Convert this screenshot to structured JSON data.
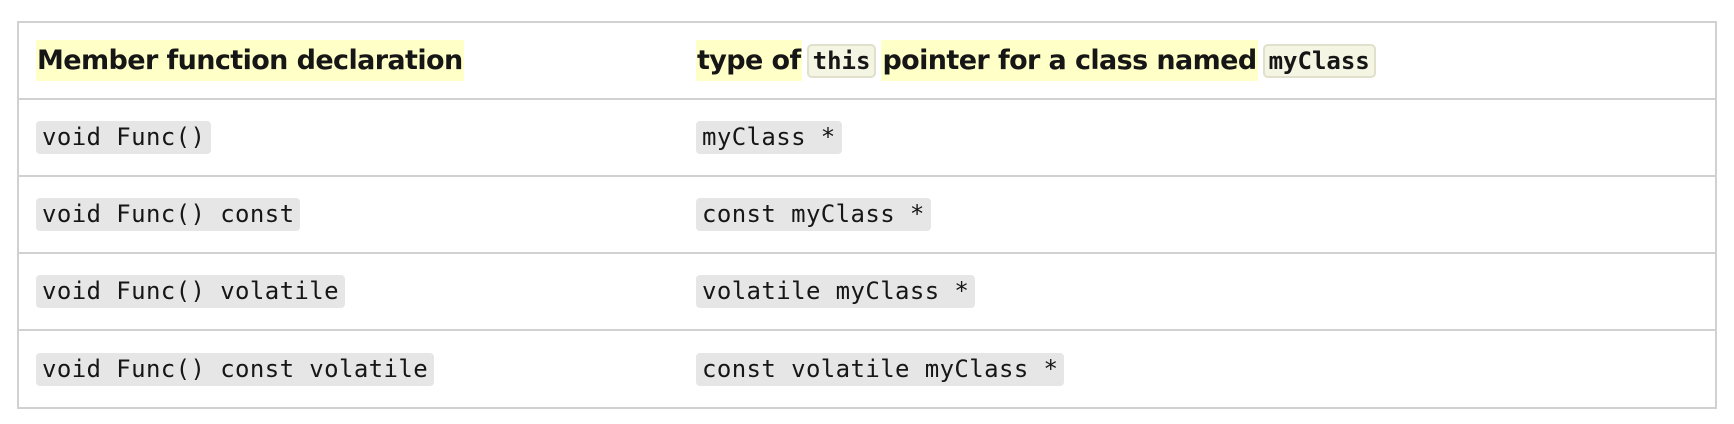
{
  "table": {
    "header": {
      "col1": "Member function declaration",
      "col2_prefix": "type of",
      "col2_code1": "this",
      "col2_mid": "pointer for a class named",
      "col2_code2": "myClass"
    },
    "rows": [
      {
        "declaration": "void Func()",
        "pointer_type": "myClass *"
      },
      {
        "declaration": "void Func() const",
        "pointer_type": "const myClass *"
      },
      {
        "declaration": "void Func() volatile",
        "pointer_type": "volatile myClass *"
      },
      {
        "declaration": "void Func() const volatile",
        "pointer_type": "const volatile myClass *"
      }
    ]
  }
}
